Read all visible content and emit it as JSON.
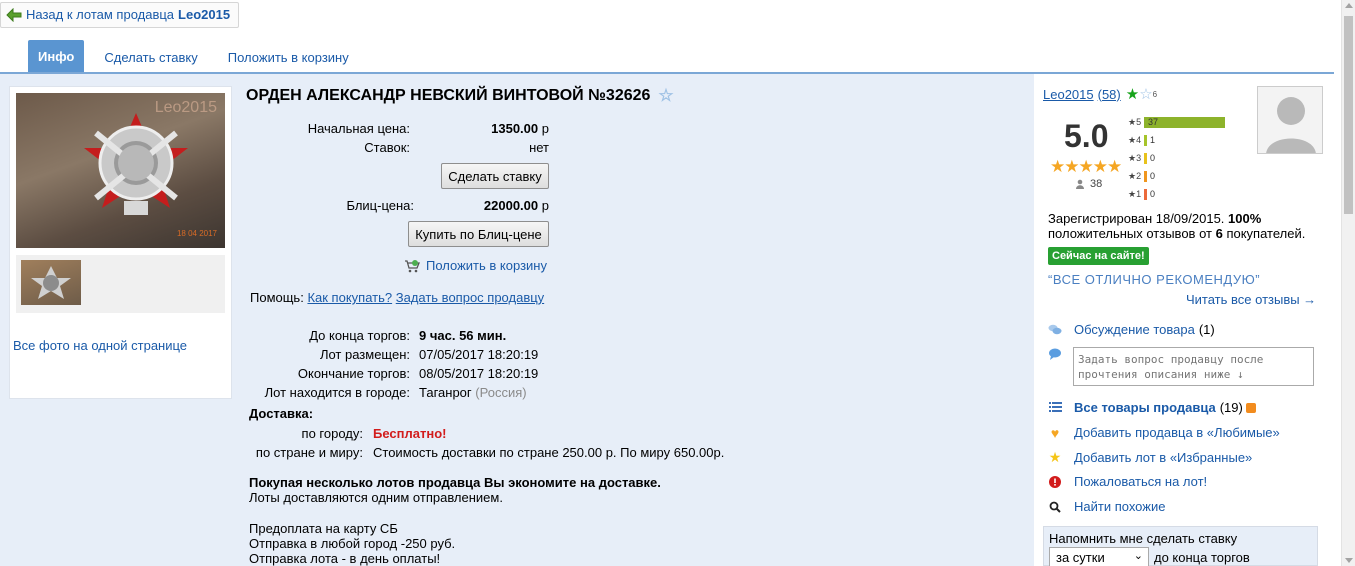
{
  "back": {
    "text": "Назад к лотам продавца",
    "seller": "Leo2015"
  },
  "tabs": [
    {
      "label": "Инфо"
    },
    {
      "label": "Сделать ставку"
    },
    {
      "label": "Положить в корзину"
    }
  ],
  "photos": {
    "watermark": "Leo2015",
    "photo_date": "18 04 2017",
    "all_photos_link": "Все фото на одной странице"
  },
  "lot": {
    "title": "ОРДЕН АЛЕКСАНДР НЕВСКИЙ ВИНТОВОЙ №32626",
    "start_price_label": "Начальная цена:",
    "start_price_value": "1350.00",
    "currency": "р",
    "bids_label": "Ставок:",
    "bids_value": "нет",
    "bid_button": "Сделать ставку",
    "blitz_label": "Блиц-цена:",
    "blitz_value": "22000.00",
    "blitz_button": "Купить по Блиц-цене",
    "cart_link": "Положить в корзину",
    "help_label": "Помощь:",
    "help_how": "Как покупать?",
    "help_ask": "Задать вопрос продавцу",
    "end_label": "До конца торгов:",
    "end_value": "9 час. 56 мин.",
    "placed_label": "Лот размещен:",
    "placed_value": "07/05/2017 18:20:19",
    "closing_label": "Окончание торгов:",
    "closing_value": "08/05/2017 18:20:19",
    "city_label": "Лот находится в городе:",
    "city_value": "Таганрог",
    "country": "(Россия)",
    "delivery_header": "Доставка:",
    "by_city_label": "по городу:",
    "by_city_value": "Бесплатно!",
    "by_country_label": "по стране и миру:",
    "by_country_value": "Стоимость доставки по стране 250.00 р. По миру 650.00р.",
    "desc_bold": "Покупая несколько лотов продавца Вы экономите на доставке.",
    "desc_line1": "Лоты доставляются одним отправлением.",
    "desc_line2": "Предоплата на карту СБ",
    "desc_line3": "Отправка в любой город -250 руб.",
    "desc_line4": "Отправка лота - в день оплаты!"
  },
  "seller": {
    "name": "Leo2015",
    "count": "(58)",
    "stars_small": "6",
    "score": "5.0",
    "reviews_count": "38",
    "ratings": [
      {
        "star": "5",
        "count": "37",
        "value": 37,
        "color": "#8db32b"
      },
      {
        "star": "4",
        "count": "1",
        "value": 1,
        "color": "#a6c42a"
      },
      {
        "star": "3",
        "count": "0",
        "value": 0,
        "color": "#e8c21b"
      },
      {
        "star": "2",
        "count": "0",
        "value": 0,
        "color": "#f0961e"
      },
      {
        "star": "1",
        "count": "0",
        "value": 0,
        "color": "#ec6a3b"
      }
    ],
    "registered_pre": "Зарегистрирован 18/09/2015.",
    "positive_pct": "100%",
    "positive_mid": "положительных отзывов от",
    "buyers_count": "6",
    "buyers_suffix": "покупателей.",
    "online_badge": "Сейчас на сайте!",
    "slogan": "“ВСЕ ОТЛИЧНО РЕКОМЕНДУЮ”",
    "read_reviews": "Читать все отзывы →"
  },
  "side_menu": {
    "discussion": "Обсуждение товара",
    "discussion_count": "(1)",
    "ask_placeholder": "Задать вопрос продавцу после прочтения описания ниже ↓",
    "all_goods": "Все товары продавца",
    "all_goods_count": "(19)",
    "add_favorite_seller": "Добавить продавца в «Любимые»",
    "add_favorite_lot": "Добавить лот в «Избранные»",
    "complain": "Пожаловаться на лот!",
    "find_similar": "Найти похожие",
    "remind_label": "Напомнить мне сделать ставку",
    "remind_select": "за сутки",
    "remind_suffix": "до конца торгов"
  },
  "colors": {
    "tab_active": "#5a95d1",
    "link": "#1a5aa8",
    "main_bg": "#e7eef8",
    "online": "#28a032",
    "free": "#d21c1c"
  }
}
